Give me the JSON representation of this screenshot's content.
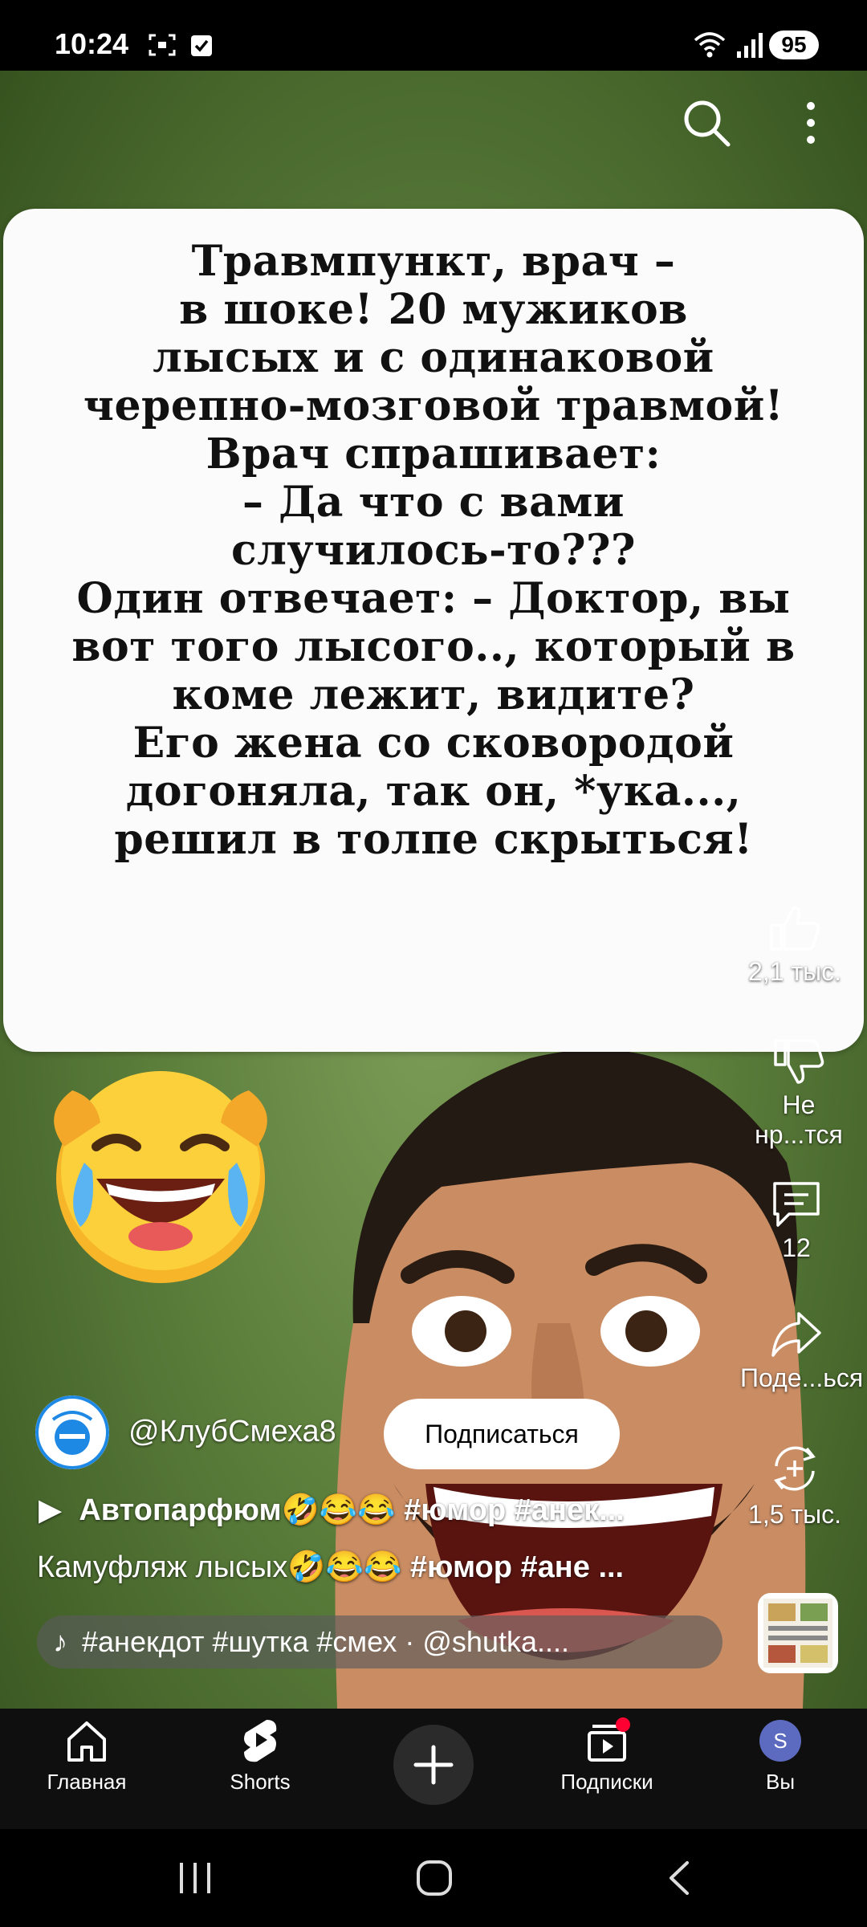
{
  "status_bar": {
    "time": "10:24",
    "battery": "95"
  },
  "video": {
    "joke_lines": [
      "Травмпункт, врач –",
      "в шоке! 20 мужиков",
      "лысых и с одинаковой",
      "черепно-мозговой травмой!",
      "Врач спрашивает:",
      "– Да что с вами",
      "случилось-то???",
      "Один отвечает: – Доктор, вы",
      "вот того лысого.., который в",
      "коме лежит, видите?",
      "Его жена со сковородой",
      "догоняла, так он, *ука...,",
      "решил в толпе скрыться!"
    ]
  },
  "actions": {
    "like_count": "2,1 тыс.",
    "dislike_label": "Не нр...тся",
    "comments_count": "12",
    "share_label": "Поде...ься",
    "remix_count": "1,5 тыс."
  },
  "channel": {
    "handle": "@КлубСмеха8",
    "subscribe_label": "Подписаться"
  },
  "playlist": {
    "title": "Автопарфюм🤣😂😂",
    "tags": "#юмор #анек..."
  },
  "description": {
    "text": "Камуфляж лысых🤣😂😂",
    "tags": "#юмор #ане ..."
  },
  "sound": {
    "label": "#анекдот #шутка #смех · @shutka...."
  },
  "bottom_nav": {
    "home": "Главная",
    "shorts": "Shorts",
    "subscriptions": "Подписки",
    "you": "Вы",
    "you_avatar_letter": "S"
  },
  "colors": {
    "background": "#000000",
    "video_green": "#5c7f3c",
    "card": "#fbfbfb",
    "notification_dot": "#ff0033",
    "avatar_purple": "#5c6bc0"
  }
}
